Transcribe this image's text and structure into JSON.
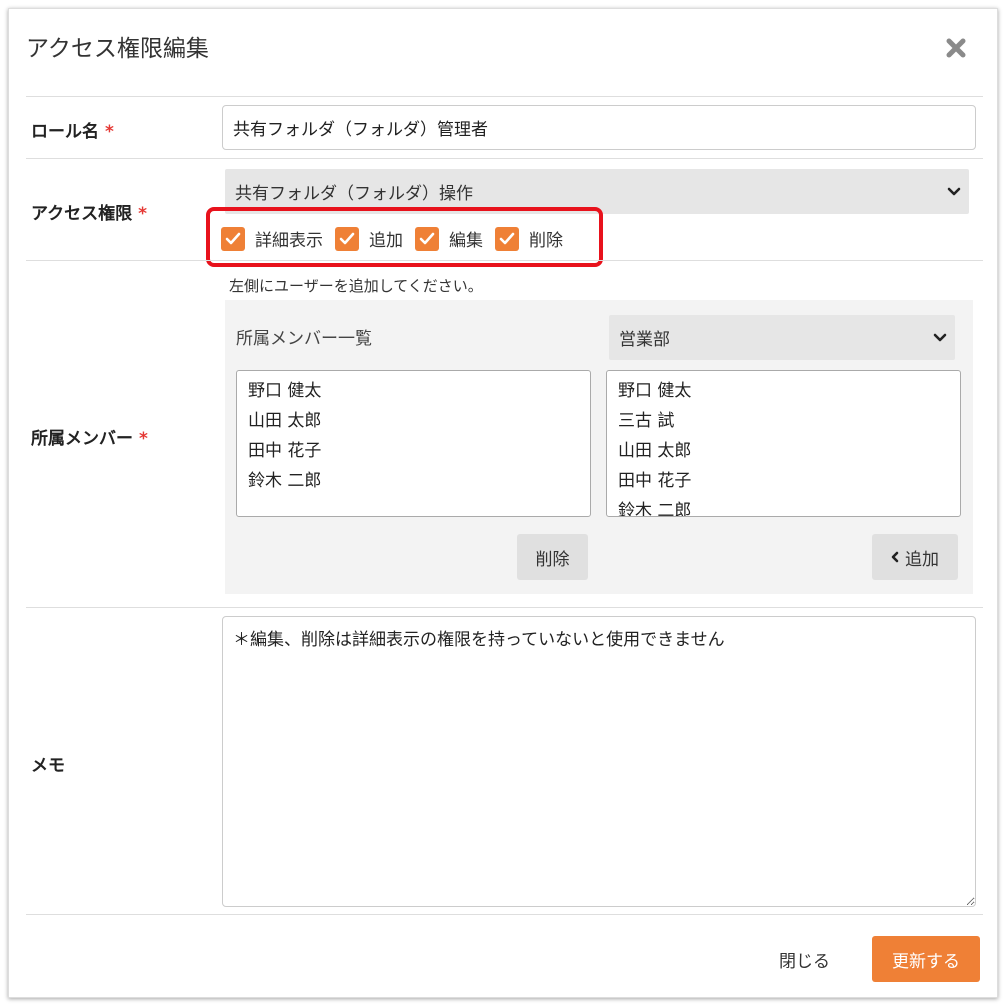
{
  "dialog": {
    "title": "アクセス権限編集"
  },
  "role": {
    "label": "ロール名",
    "required_mark": "*",
    "value": "共有フォルダ（フォルダ）管理者"
  },
  "access": {
    "label": "アクセス権限",
    "required_mark": "*",
    "selected": "共有フォルダ（フォルダ）操作",
    "permissions": [
      {
        "label": "詳細表示",
        "checked": true
      },
      {
        "label": "追加",
        "checked": true
      },
      {
        "label": "編集",
        "checked": true
      },
      {
        "label": "削除",
        "checked": true
      }
    ]
  },
  "members": {
    "label": "所属メンバー",
    "required_mark": "*",
    "hint": "左側にユーザーを追加してください。",
    "panel_title": "所属メンバー一覧",
    "department_selected": "営業部",
    "assigned": [
      "野口 健太",
      "山田 太郎",
      "田中 花子",
      "鈴木 二郎"
    ],
    "available": [
      "野口 健太",
      "三古 試",
      "山田 太郎",
      "田中 花子",
      "鈴木 二郎"
    ],
    "remove_label": "削除",
    "add_label": "追加"
  },
  "memo": {
    "label": "メモ",
    "value": "＊編集、削除は詳細表示の権限を持っていないと使用できません"
  },
  "footer": {
    "close_label": "閉じる",
    "update_label": "更新する"
  },
  "colors": {
    "accent": "#ef8036",
    "required": "#e53935",
    "highlight": "#e8121c"
  }
}
